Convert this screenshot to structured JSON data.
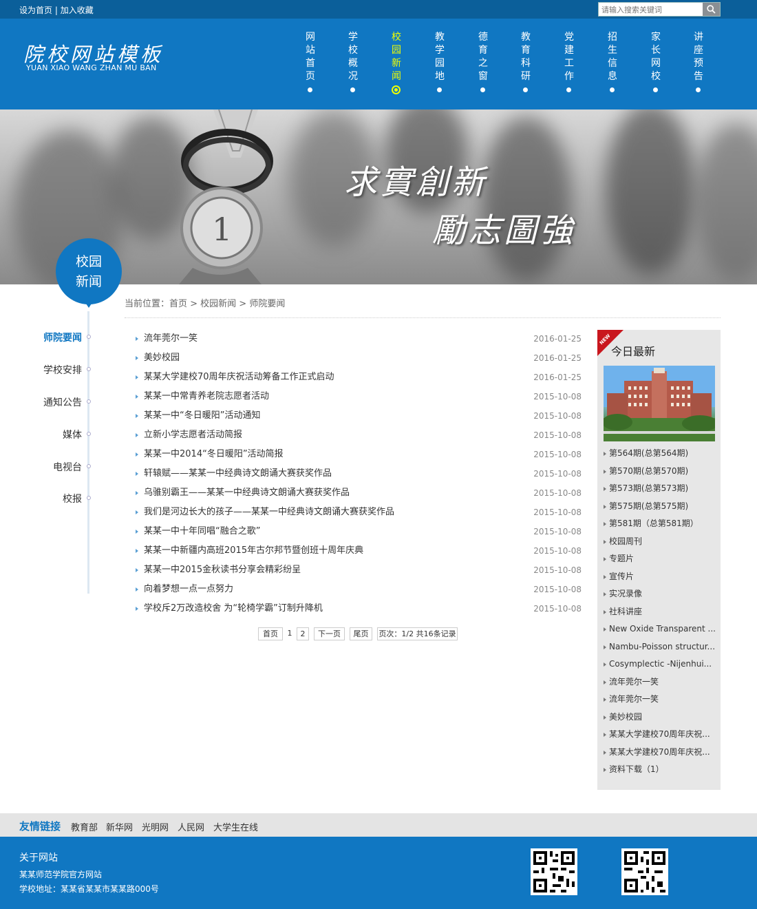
{
  "topbar": {
    "set_home": "设为首页",
    "separator": "|",
    "add_favorite": "加入收藏",
    "search_placeholder": "请输入搜索关键词",
    "search_icon": "search-icon"
  },
  "logo": {
    "cn": "院校网站模板",
    "en": "YUAN XIAO WANG ZHAN MU BAN"
  },
  "nav": {
    "items": [
      {
        "label": "网站首页"
      },
      {
        "label": "学校概况"
      },
      {
        "label": "校园新闻",
        "active": true
      },
      {
        "label": "教学园地"
      },
      {
        "label": "德育之窗"
      },
      {
        "label": "教育科研"
      },
      {
        "label": "党建工作"
      },
      {
        "label": "招生信息"
      },
      {
        "label": "家长网校"
      },
      {
        "label": "讲座预告"
      }
    ]
  },
  "banner": {
    "slogan1": "求實創新",
    "slogan2": "勵志圖強"
  },
  "section_badge": {
    "line1": "校园",
    "line2": "新闻"
  },
  "side_nav": {
    "items": [
      {
        "label": "师院要闻",
        "active": true
      },
      {
        "label": "学校安排"
      },
      {
        "label": "通知公告"
      },
      {
        "label": "媒体"
      },
      {
        "label": "电视台"
      },
      {
        "label": "校报"
      }
    ]
  },
  "breadcrumb": {
    "text": "当前位置：首页 > 校园新闻 > 师院要闻"
  },
  "news": [
    {
      "title": "流年莞尔一笑",
      "date": "2016-01-25"
    },
    {
      "title": "美妙校园",
      "date": "2016-01-25"
    },
    {
      "title": "某某大学建校70周年庆祝活动筹备工作正式启动",
      "date": "2016-01-25"
    },
    {
      "title": "某某一中常青养老院志愿者活动",
      "date": "2015-10-08"
    },
    {
      "title": "某某一中“冬日暖阳”活动通知",
      "date": "2015-10-08"
    },
    {
      "title": "立新小学志愿者活动简报",
      "date": "2015-10-08"
    },
    {
      "title": "某某一中2014“冬日暖阳”活动简报",
      "date": "2015-10-08"
    },
    {
      "title": "轩辕赋——某某一中经典诗文朗诵大赛获奖作品",
      "date": "2015-10-08"
    },
    {
      "title": "乌骓别霸王——某某一中经典诗文朗诵大赛获奖作品",
      "date": "2015-10-08"
    },
    {
      "title": "我们是河边长大的孩子——某某一中经典诗文朗诵大赛获奖作品",
      "date": "2015-10-08"
    },
    {
      "title": "某某一中十年同唱“融合之歌”",
      "date": "2015-10-08"
    },
    {
      "title": "某某一中新疆内高班2015年古尔邦节暨创班十周年庆典",
      "date": "2015-10-08"
    },
    {
      "title": "某某一中2015金秋读书分享会精彩纷呈",
      "date": "2015-10-08"
    },
    {
      "title": "向着梦想一点一点努力",
      "date": "2015-10-08"
    },
    {
      "title": "学校斥2万改造校舍 为“轮椅学霸”订制升降机",
      "date": "2015-10-08"
    }
  ],
  "pager": {
    "first": "首页",
    "page1": "1",
    "page2": "2",
    "next": "下一页",
    "last": "尾页",
    "info": "页次：1/2 共16条记录"
  },
  "right_box": {
    "ribbon": "NEW",
    "title": "今日最新",
    "items": [
      "第564期(总第564期)",
      "第570期(总第570期)",
      "第573期(总第573期)",
      "第575期(总第575期)",
      "第581期（总第581期）",
      "校园周刊",
      "专题片",
      "宣传片",
      "实况录像",
      "社科讲座",
      "New Oxide Transparent ...",
      "Nambu-Poisson structur...",
      "Cosymplectic -Nijenhui...",
      "流年莞尔一笑",
      "流年莞尔一笑",
      "美妙校园",
      "某某大学建校70周年庆祝...",
      "某某大学建校70周年庆祝...",
      "资料下载（1）"
    ]
  },
  "friends": {
    "title": "友情链接",
    "links": [
      "教育部",
      "新华网",
      "光明网",
      "人民网",
      "大学生在线"
    ]
  },
  "footer": {
    "about": "关于网站",
    "line1": "某某师范学院官方网站",
    "line2": "学校地址：某某省某某市某某路000号"
  },
  "colors": {
    "brand_blue": "#1077c2",
    "topbar_blue": "#0b5f9a",
    "active_nav": "#f0ff00",
    "ribbon_red": "#c9171e"
  }
}
